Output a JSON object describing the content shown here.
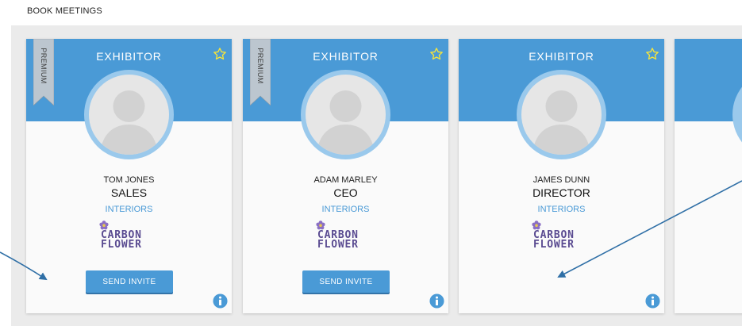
{
  "page": {
    "heading": "BOOK MEETINGS"
  },
  "colors": {
    "accent": "#4a9ad6",
    "avatar_ring": "#9ac9ec",
    "brand": "#5a4b91",
    "background_strip": "#ebebeb"
  },
  "cards": [
    {
      "label": "EXHIBITOR",
      "ribbon": "PREMIUM",
      "name": "TOM JONES",
      "role": "SALES",
      "company": "INTERIORS",
      "brand_line1": "CARBON",
      "brand_line2": "FLOWER",
      "button": "SEND INVITE",
      "star_icon": "star-outline-icon",
      "info_icon": "info-icon"
    },
    {
      "label": "EXHIBITOR",
      "ribbon": "PREMIUM",
      "name": "ADAM MARLEY",
      "role": "CEO",
      "company": "INTERIORS",
      "brand_line1": "CARBON",
      "brand_line2": "FLOWER",
      "button": "SEND INVITE",
      "star_icon": "star-outline-icon",
      "info_icon": "info-icon"
    },
    {
      "label": "EXHIBITOR",
      "name": "JAMES DUNN",
      "role": "DIRECTOR",
      "company": "INTERIORS",
      "brand_line1": "CARBON",
      "brand_line2": "FLOWER",
      "star_icon": "star-outline-icon",
      "info_icon": "info-icon"
    }
  ],
  "annotations": {
    "arrow_icon": "pointer-arrow-icon",
    "count": 2
  }
}
